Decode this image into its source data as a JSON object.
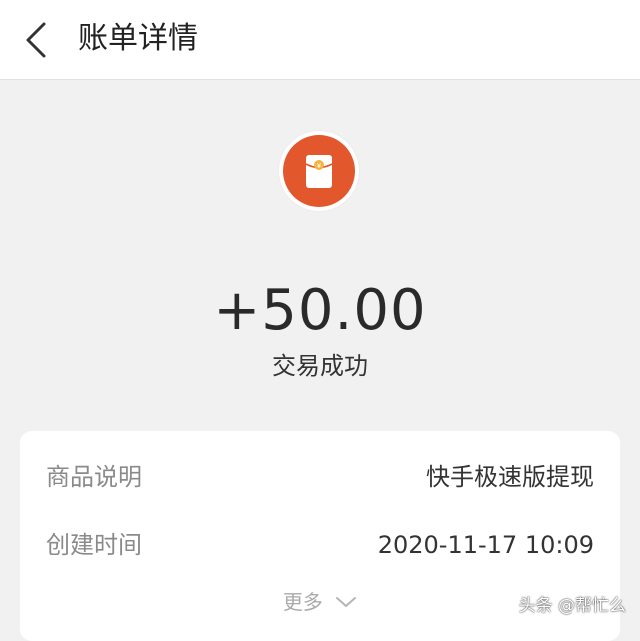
{
  "header": {
    "title": "账单详情",
    "back_icon": "chevron-left-icon"
  },
  "transaction": {
    "icon": "red-envelope-icon",
    "icon_color": "#e2572c",
    "amount": "+50.00",
    "status": "交易成功"
  },
  "details": {
    "rows": [
      {
        "label": "商品说明",
        "value": "快手极速版提现"
      },
      {
        "label": "创建时间",
        "value": "2020-11-17 10:09"
      }
    ],
    "more_label": "更多",
    "more_icon": "chevron-down-icon"
  },
  "watermark": {
    "text": "头条 @帮忙么"
  },
  "colors": {
    "background": "#f1f1f1",
    "card": "#ffffff",
    "accent": "#e2572c"
  }
}
